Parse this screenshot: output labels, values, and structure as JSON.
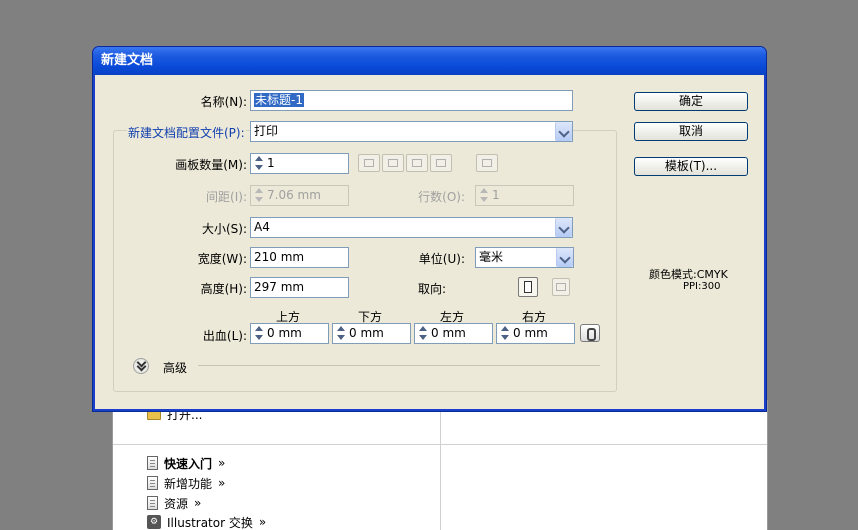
{
  "background_panel": {
    "open_label": "打开...",
    "items": [
      {
        "label": "快速入门",
        "arrow": "»"
      },
      {
        "label": "新增功能",
        "arrow": "»"
      },
      {
        "label": "资源",
        "arrow": "»"
      },
      {
        "label": "Illustrator 交换",
        "arrow": "»"
      }
    ]
  },
  "dialog": {
    "title": "新建文档",
    "name": {
      "label": "名称(N):",
      "value": "未标题-1"
    },
    "profile": {
      "label": "新建文档配置文件(P):",
      "value": "打印"
    },
    "artboards": {
      "label": "画板数量(M):",
      "value": "1"
    },
    "spacing": {
      "label": "间距(I):",
      "value": "7.06 mm"
    },
    "columns": {
      "label": "行数(O):",
      "value": "1"
    },
    "size": {
      "label": "大小(S):",
      "value": "A4"
    },
    "width": {
      "label": "宽度(W):",
      "value": "210 mm"
    },
    "units": {
      "label": "单位(U):",
      "value": "毫米"
    },
    "height": {
      "label": "高度(H):",
      "value": "297 mm"
    },
    "orientation": {
      "label": "取向:"
    },
    "bleed": {
      "label": "出血(L):",
      "top": {
        "label": "上方",
        "value": "0 mm"
      },
      "bottom": {
        "label": "下方",
        "value": "0 mm"
      },
      "left": {
        "label": "左方",
        "value": "0 mm"
      },
      "right": {
        "label": "右方",
        "value": "0 mm"
      }
    },
    "advanced_label": "高级",
    "buttons": {
      "ok": "确定",
      "cancel": "取消",
      "templates": "模板(T)..."
    },
    "color_mode_text": "颜色模式:CMYK",
    "ppi_text": "PPI:300"
  },
  "colors": {
    "titlebar": "#0a4ad8",
    "dialog_bg": "#ece9d8",
    "label_blue": "#1240b0"
  }
}
